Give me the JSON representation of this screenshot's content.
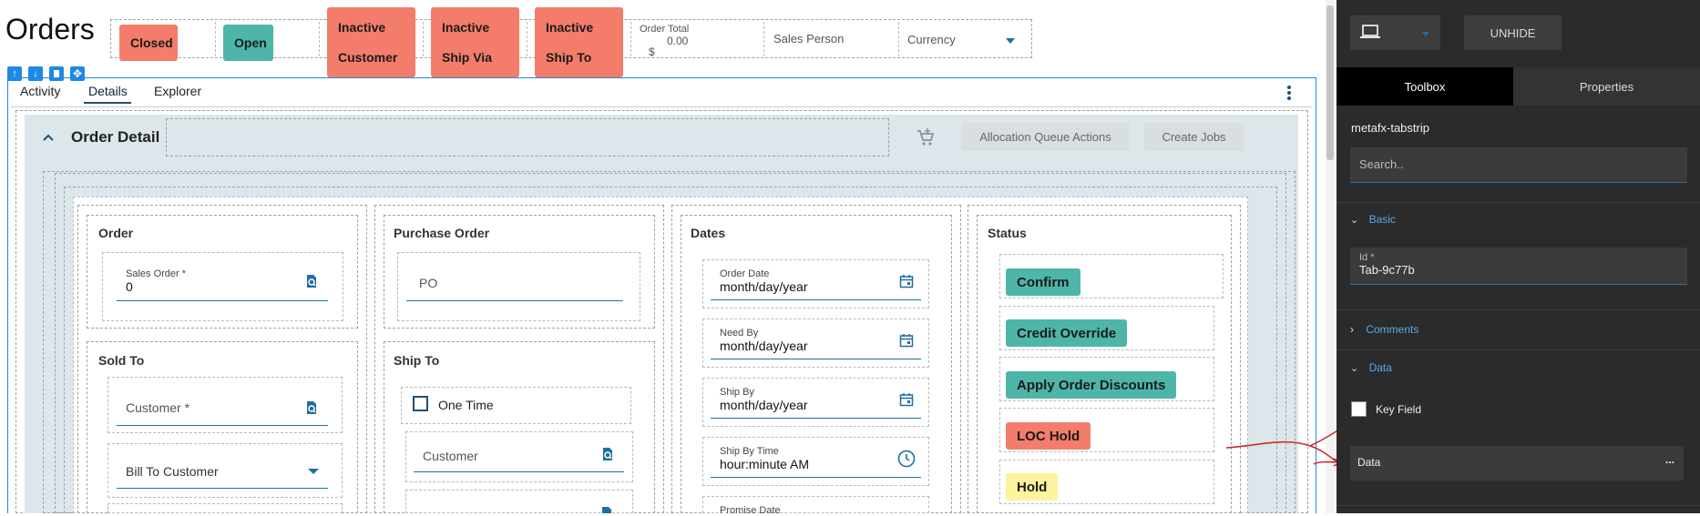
{
  "page": {
    "title": "Orders"
  },
  "header": {
    "chips": [
      {
        "label": "Closed"
      },
      {
        "label": "Open"
      },
      {
        "line1": "Inactive",
        "line2": "Customer"
      },
      {
        "line1": "Inactive",
        "line2": "Ship Via"
      },
      {
        "line1": "Inactive",
        "line2": "Ship To"
      }
    ],
    "order_total": {
      "label": "Order Total",
      "value": "0.00",
      "currency_symbol": "$"
    },
    "sales_person": {
      "label": "Sales Person"
    },
    "currency": {
      "label": "Currency"
    }
  },
  "tabs": [
    {
      "label": "Activity"
    },
    {
      "label": "Details",
      "active": true
    },
    {
      "label": "Explorer"
    }
  ],
  "order_detail": {
    "title": "Order Detail",
    "buttons": {
      "allocation": "Allocation Queue Actions",
      "create_jobs": "Create Jobs"
    }
  },
  "order_section": {
    "title": "Order",
    "sales_order": {
      "label": "Sales Order *",
      "value": "0"
    }
  },
  "purchase_order_section": {
    "title": "Purchase Order",
    "po": {
      "placeholder": "PO"
    }
  },
  "dates_section": {
    "title": "Dates",
    "fields": [
      {
        "label": "Order Date",
        "value": "month/day/year"
      },
      {
        "label": "Need By",
        "value": "month/day/year"
      },
      {
        "label": "Ship By",
        "value": "month/day/year"
      },
      {
        "label": "Ship By Time",
        "value": "hour:minute AM"
      },
      {
        "label": "Promise Date",
        "value": ""
      }
    ]
  },
  "status_section": {
    "title": "Status",
    "buttons": [
      {
        "label": "Confirm",
        "color": "#4db6a9"
      },
      {
        "label": "Credit Override",
        "color": "#4db6a9"
      },
      {
        "label": "Apply Order Discounts",
        "color": "#4db6a9"
      },
      {
        "label": "LOC Hold",
        "color": "#f47c6b"
      },
      {
        "label": "Hold",
        "color": "#fdf29e"
      }
    ]
  },
  "sold_to_section": {
    "title": "Sold To",
    "customer": {
      "placeholder": "Customer *"
    },
    "bill_to": {
      "value": "Bill To Customer"
    }
  },
  "ship_to_section": {
    "title": "Ship To",
    "one_time": {
      "label": "One Time"
    },
    "customer": {
      "placeholder": "Customer"
    }
  },
  "right_panel": {
    "unhide_label": "UNHIDE",
    "tabs": {
      "toolbox": "Toolbox",
      "properties": "Properties"
    },
    "component_name": "metafx-tabstrip",
    "search_placeholder": "Search..",
    "sections": {
      "basic": "Basic",
      "comments": "Comments",
      "data": "Data"
    },
    "id_field": {
      "label": "Id *",
      "value": "Tab-9c77b"
    },
    "key_field": {
      "label": "Key Field"
    },
    "data_field": {
      "label": "Data",
      "more": "..."
    }
  },
  "colors": {
    "red_chip": "#f47c6b",
    "teal_chip": "#4db6a9",
    "yellow_chip": "#fdf29e",
    "accent_blue": "#1e6f9f",
    "panel_bg": "#2a2a2a"
  }
}
